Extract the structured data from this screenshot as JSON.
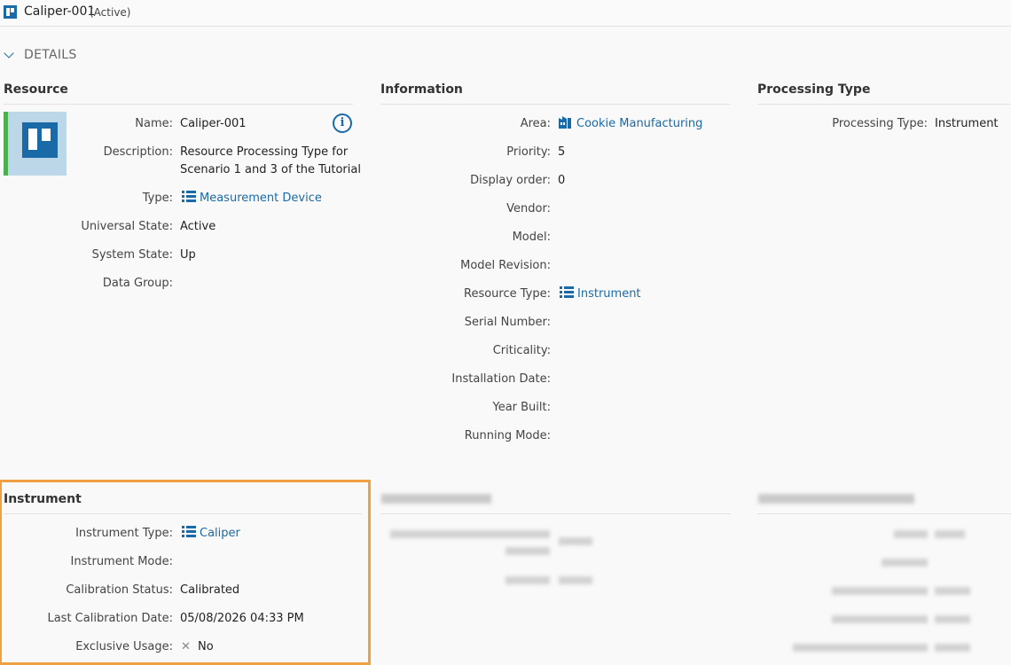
{
  "header": {
    "title": "Caliper-001",
    "status": "(Active)"
  },
  "details_label": "DETAILS",
  "resource": {
    "heading": "Resource",
    "name_label": "Name:",
    "name": "Caliper-001",
    "description_label": "Description:",
    "description_line1": "Resource Processing Type for",
    "description_line2": "Scenario 1 and 3 of the Tutorial",
    "type_label": "Type:",
    "type": "Measurement Device",
    "universal_state_label": "Universal State:",
    "universal_state": "Active",
    "system_state_label": "System State:",
    "system_state": "Up",
    "data_group_label": "Data Group:",
    "data_group": ""
  },
  "information": {
    "heading": "Information",
    "area_label": "Area:",
    "area": "Cookie Manufacturing",
    "priority_label": "Priority:",
    "priority": "5",
    "display_order_label": "Display order:",
    "display_order": "0",
    "vendor_label": "Vendor:",
    "model_label": "Model:",
    "model_revision_label": "Model Revision:",
    "resource_type_label": "Resource Type:",
    "resource_type": "Instrument",
    "serial_number_label": "Serial Number:",
    "criticality_label": "Criticality:",
    "installation_date_label": "Installation Date:",
    "year_built_label": "Year Built:",
    "running_mode_label": "Running Mode:"
  },
  "processing_type": {
    "heading": "Processing Type",
    "label": "Processing Type:",
    "value": "Instrument"
  },
  "instrument": {
    "heading": "Instrument",
    "instrument_type_label": "Instrument Type:",
    "instrument_type": "Caliper",
    "instrument_mode_label": "Instrument Mode:",
    "calibration_status_label": "Calibration Status:",
    "calibration_status": "Calibrated",
    "last_calibration_label": "Last Calibration Date:",
    "last_calibration": "05/08/2026 04:33 PM",
    "exclusive_usage_label": "Exclusive Usage:",
    "exclusive_usage_symbol": "✕",
    "exclusive_usage": "No"
  },
  "colors": {
    "accent": "#1a6aa8",
    "state_bar": "#4caf50",
    "highlight": "#f0a040"
  }
}
